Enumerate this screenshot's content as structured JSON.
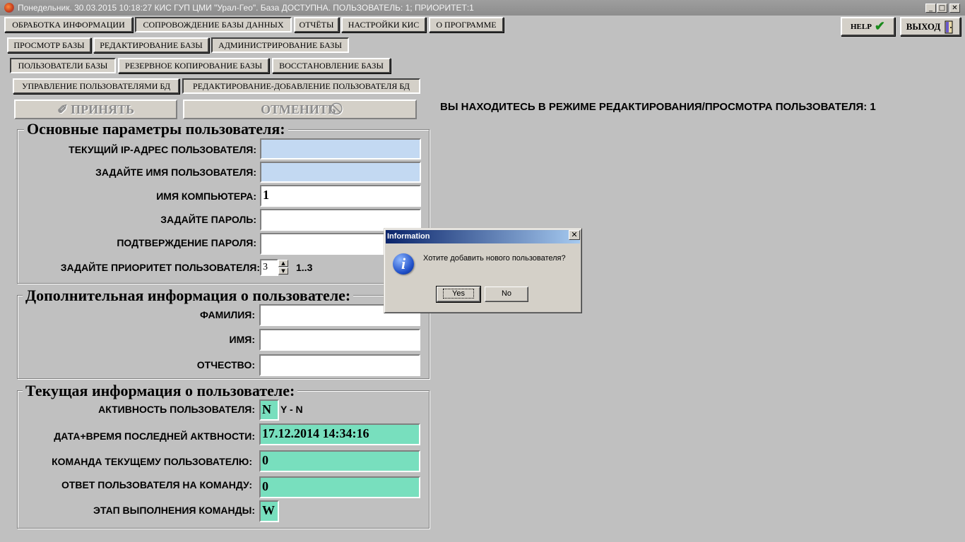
{
  "window": {
    "title": "Понедельник. 30.03.2015 10:18:27 КИС ГУП ЦМИ \"Урал-Гео\". База ДОСТУПНА. ПОЛЬЗОВАТЕЛЬ: 1; ПРИОРИТЕТ:1",
    "minimize": "_",
    "maximize": "□",
    "close": "✕"
  },
  "main_tabs": [
    "ОБРАБОТКА ИНФОРМАЦИИ",
    "СОПРОВОЖДЕНИЕ БАЗЫ ДАННЫХ",
    "ОТЧЁТЫ",
    "НАСТРОЙКИ КИС",
    "О ПРОГРАММЕ"
  ],
  "sub_tabs": [
    "ПРОСМОТР БАЗЫ",
    "РЕДАКТИРОВАНИЕ БАЗЫ",
    "АДМИНИСТРИРОВАНИЕ БАЗЫ"
  ],
  "admin_tabs": [
    "ПОЛЬЗОВАТЕЛИ БАЗЫ",
    "РЕЗЕРВНОЕ КОПИРОВАНИЕ БАЗЫ",
    "ВОССТАНОВЛЕНИЕ БАЗЫ"
  ],
  "user_tabs": [
    "УПРАВЛЕНИЕ ПОЛЬЗОВАТЕЛЯМИ БД",
    "РЕДАКТИРОВАНИЕ-ДОБАВЛЕНИЕ  ПОЛЬЗОВАТЕЛЯ БД"
  ],
  "toolbar": {
    "help": "HELP",
    "exit": "ВЫХОД"
  },
  "actions": {
    "accept": "ПРИНЯТЬ",
    "cancel": "ОТМЕНИТЬ"
  },
  "mode_text": "ВЫ НАХОДИТЕСЬ В РЕЖИМЕ РЕДАКТИРОВАНИЯ/ПРОСМОТРА ПОЛЬЗОВАТЕЛЯ: 1",
  "basic": {
    "legend": "Основные параметры пользователя:",
    "ip_label": "ТЕКУЩИЙ IP-АДРЕС ПОЛЬЗОВАТЕЛЯ:",
    "ip_value": "",
    "name_label": "ЗАДАЙТЕ ИМЯ ПОЛЬЗОВАТЕЛЯ:",
    "name_value": "",
    "computer_label": "ИМЯ КОМПЬЮТЕРА:",
    "computer_value": "1",
    "password_label": "ЗАДАЙТЕ ПАРОЛЬ:",
    "password_value": "",
    "confirm_label": "ПОДТВЕРЖДЕНИЕ ПАРОЛЯ:",
    "confirm_value": "",
    "priority_label": "ЗАДАЙТЕ ПРИОРИТЕТ ПОЛЬЗОВАТЕЛЯ:",
    "priority_value": "3",
    "priority_range": "1..3"
  },
  "extra": {
    "legend": "Дополнительная информация о пользователе:",
    "surname_label": "ФАМИЛИЯ:",
    "surname_value": "",
    "firstname_label": "ИМЯ:",
    "firstname_value": "",
    "patronymic_label": "ОТЧЕСТВО:",
    "patronymic_value": ""
  },
  "current": {
    "legend": "Текущая информация о пользователе:",
    "activity_label": "АКТИВНОСТЬ ПОЛЬЗОВАТЕЛЯ:",
    "activity_value": "N",
    "activity_hint": "Y - N",
    "last_label": "ДАТА+ВРЕМЯ ПОСЛЕДНЕЙ АКТВНОСТИ:",
    "last_value": "17.12.2014 14:34:16",
    "command_label": "КОМАНДА ТЕКУЩЕМУ ПОЛЬЗОВАТЕЛЮ:",
    "command_value": "0",
    "answer_label": "ОТВЕТ ПОЛЬЗОВАТЕЛЯ НА КОМАНДУ:",
    "answer_value": "0",
    "stage_label": "ЭТАП ВЫПОЛНЕНИЯ КОМАНДЫ:",
    "stage_value": "W"
  },
  "dialog": {
    "title": "Information",
    "close": "✕",
    "message": "Хотите добавить нового пользователя?",
    "yes": "Yes",
    "no": "No",
    "icon": "info-icon"
  },
  "colors": {
    "background": "#c0c0c0",
    "field_blue": "#c3d9f2",
    "field_green": "#78dfbe",
    "dialog_title": "#0a246a"
  }
}
